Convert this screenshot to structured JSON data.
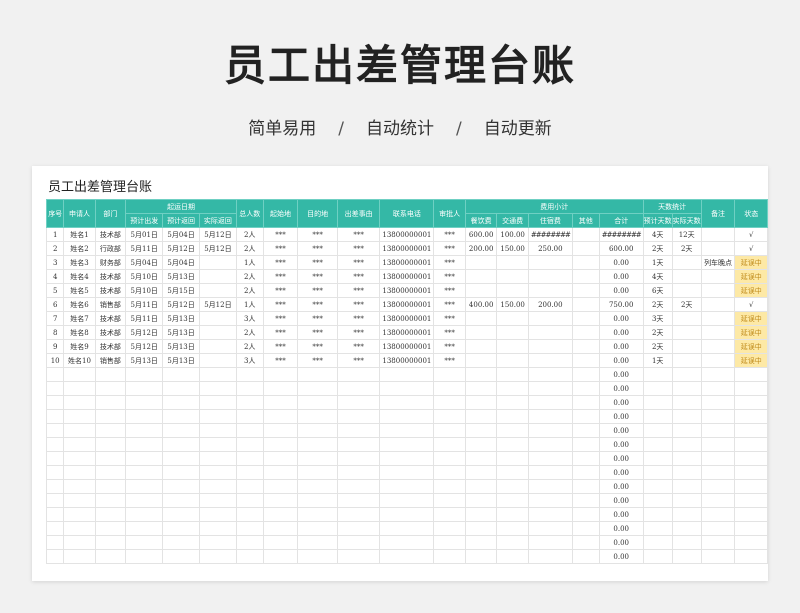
{
  "header": {
    "title": "员工出差管理台账",
    "features": [
      "简单易用",
      "自动统计",
      "自动更新"
    ],
    "separator": "/"
  },
  "sheet": {
    "title": "员工出差管理台账",
    "columns": {
      "seq": "序号",
      "applicant": "申请人",
      "dept": "部门",
      "dates_group": "起运日期",
      "plan_depart": "预计出发",
      "plan_return": "预计返回",
      "actual_return": "实际返回",
      "headcount": "总人数",
      "origin": "起始地",
      "destination": "目的地",
      "purpose": "出差事由",
      "phone": "联系电话",
      "approver": "审批人",
      "cost_group": "费用小计",
      "meal": "餐饮费",
      "transport": "交通费",
      "lodging": "住宿费",
      "other": "其他",
      "total": "合计",
      "days_group": "天数统计",
      "plan_days": "预计天数",
      "actual_days": "实际天数",
      "remark": "备注",
      "status": "状态"
    },
    "rows": [
      {
        "seq": "1",
        "name": "姓名1",
        "dept": "技术部",
        "plan_depart": "5月01日",
        "plan_return": "5月04日",
        "actual_return": "5月12日",
        "headcount": "2人",
        "origin": "***",
        "destination": "***",
        "purpose": "***",
        "phone": "13800000001",
        "approver": "***",
        "meal": "600.00",
        "transport": "100.00",
        "lodging": "########",
        "other": "",
        "total": "########",
        "plan_days": "4天",
        "actual_days": "12天",
        "remark": "",
        "status": "√"
      },
      {
        "seq": "2",
        "name": "姓名2",
        "dept": "行政部",
        "plan_depart": "5月11日",
        "plan_return": "5月12日",
        "actual_return": "5月12日",
        "headcount": "2人",
        "origin": "***",
        "destination": "***",
        "purpose": "***",
        "phone": "13800000001",
        "approver": "***",
        "meal": "200.00",
        "transport": "150.00",
        "lodging": "250.00",
        "other": "",
        "total": "600.00",
        "plan_days": "2天",
        "actual_days": "2天",
        "remark": "",
        "status": "√"
      },
      {
        "seq": "3",
        "name": "姓名3",
        "dept": "财务部",
        "plan_depart": "5月04日",
        "plan_return": "5月04日",
        "actual_return": "",
        "headcount": "1人",
        "origin": "***",
        "destination": "***",
        "purpose": "***",
        "phone": "13800000001",
        "approver": "***",
        "meal": "",
        "transport": "",
        "lodging": "",
        "other": "",
        "total": "0.00",
        "plan_days": "1天",
        "actual_days": "",
        "remark": "列车晚点",
        "status": "延误中"
      },
      {
        "seq": "4",
        "name": "姓名4",
        "dept": "技术部",
        "plan_depart": "5月10日",
        "plan_return": "5月13日",
        "actual_return": "",
        "headcount": "2人",
        "origin": "***",
        "destination": "***",
        "purpose": "***",
        "phone": "13800000001",
        "approver": "***",
        "meal": "",
        "transport": "",
        "lodging": "",
        "other": "",
        "total": "0.00",
        "plan_days": "4天",
        "actual_days": "",
        "remark": "",
        "status": "延误中"
      },
      {
        "seq": "5",
        "name": "姓名5",
        "dept": "技术部",
        "plan_depart": "5月10日",
        "plan_return": "5月15日",
        "actual_return": "",
        "headcount": "2人",
        "origin": "***",
        "destination": "***",
        "purpose": "***",
        "phone": "13800000001",
        "approver": "***",
        "meal": "",
        "transport": "",
        "lodging": "",
        "other": "",
        "total": "0.00",
        "plan_days": "6天",
        "actual_days": "",
        "remark": "",
        "status": "延误中"
      },
      {
        "seq": "6",
        "name": "姓名6",
        "dept": "销售部",
        "plan_depart": "5月11日",
        "plan_return": "5月12日",
        "actual_return": "5月12日",
        "headcount": "1人",
        "origin": "***",
        "destination": "***",
        "purpose": "***",
        "phone": "13800000001",
        "approver": "***",
        "meal": "400.00",
        "transport": "150.00",
        "lodging": "200.00",
        "other": "",
        "total": "750.00",
        "plan_days": "2天",
        "actual_days": "2天",
        "remark": "",
        "status": "√"
      },
      {
        "seq": "7",
        "name": "姓名7",
        "dept": "技术部",
        "plan_depart": "5月11日",
        "plan_return": "5月13日",
        "actual_return": "",
        "headcount": "3人",
        "origin": "***",
        "destination": "***",
        "purpose": "***",
        "phone": "13800000001",
        "approver": "***",
        "meal": "",
        "transport": "",
        "lodging": "",
        "other": "",
        "total": "0.00",
        "plan_days": "3天",
        "actual_days": "",
        "remark": "",
        "status": "延误中"
      },
      {
        "seq": "8",
        "name": "姓名8",
        "dept": "技术部",
        "plan_depart": "5月12日",
        "plan_return": "5月13日",
        "actual_return": "",
        "headcount": "2人",
        "origin": "***",
        "destination": "***",
        "purpose": "***",
        "phone": "13800000001",
        "approver": "***",
        "meal": "",
        "transport": "",
        "lodging": "",
        "other": "",
        "total": "0.00",
        "plan_days": "2天",
        "actual_days": "",
        "remark": "",
        "status": "延误中"
      },
      {
        "seq": "9",
        "name": "姓名9",
        "dept": "技术部",
        "plan_depart": "5月12日",
        "plan_return": "5月13日",
        "actual_return": "",
        "headcount": "2人",
        "origin": "***",
        "destination": "***",
        "purpose": "***",
        "phone": "13800000001",
        "approver": "***",
        "meal": "",
        "transport": "",
        "lodging": "",
        "other": "",
        "total": "0.00",
        "plan_days": "2天",
        "actual_days": "",
        "remark": "",
        "status": "延误中"
      },
      {
        "seq": "10",
        "name": "姓名10",
        "dept": "销售部",
        "plan_depart": "5月13日",
        "plan_return": "5月13日",
        "actual_return": "",
        "headcount": "3人",
        "origin": "***",
        "destination": "***",
        "purpose": "***",
        "phone": "13800000001",
        "approver": "***",
        "meal": "",
        "transport": "",
        "lodging": "",
        "other": "",
        "total": "0.00",
        "plan_days": "1天",
        "actual_days": "",
        "remark": "",
        "status": "延误中"
      }
    ],
    "empty_total": "0.00",
    "empty_row_count": 14,
    "delay_status": "延误中",
    "colors": {
      "header_bg": "#34b8a6",
      "delay_bg": "#fde9a6",
      "delay_text": "#c08a19"
    }
  }
}
